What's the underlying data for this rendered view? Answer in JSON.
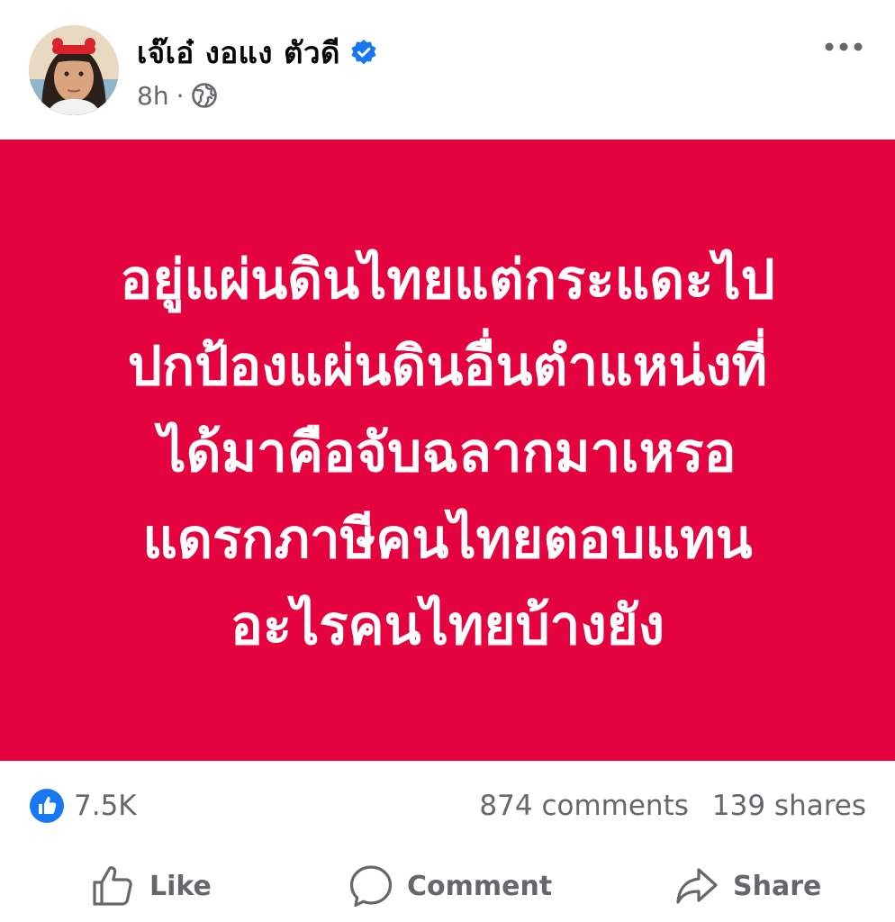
{
  "post": {
    "author_name": "เจ๊เอ๋ งอแง ตัวดี",
    "time": "8h",
    "separator": "·",
    "avatar_icon": "avatar",
    "verified_icon": "verified-badge-icon",
    "privacy_icon": "globe-icon",
    "more_icon": "more-options-icon"
  },
  "content": {
    "background_color": "#e4023f",
    "text_color": "#ffffff",
    "lines": [
      "อยู่แผ่นดินไทยแต่กระแดะไป",
      "ปกป้องแผ่นดินอื่นตำแหน่งที่",
      "ได้มาคือจับฉลากมาเหรอ",
      "แดรกภาษีคนไทยตอบแทน",
      "อะไรคนไทยบ้างยัง"
    ]
  },
  "stats": {
    "likes": "7.5K",
    "comments": "874 comments",
    "shares": "139 shares",
    "like_badge_color": "#1877f2"
  },
  "actions": {
    "like_label": "Like",
    "comment_label": "Comment",
    "share_label": "Share"
  }
}
